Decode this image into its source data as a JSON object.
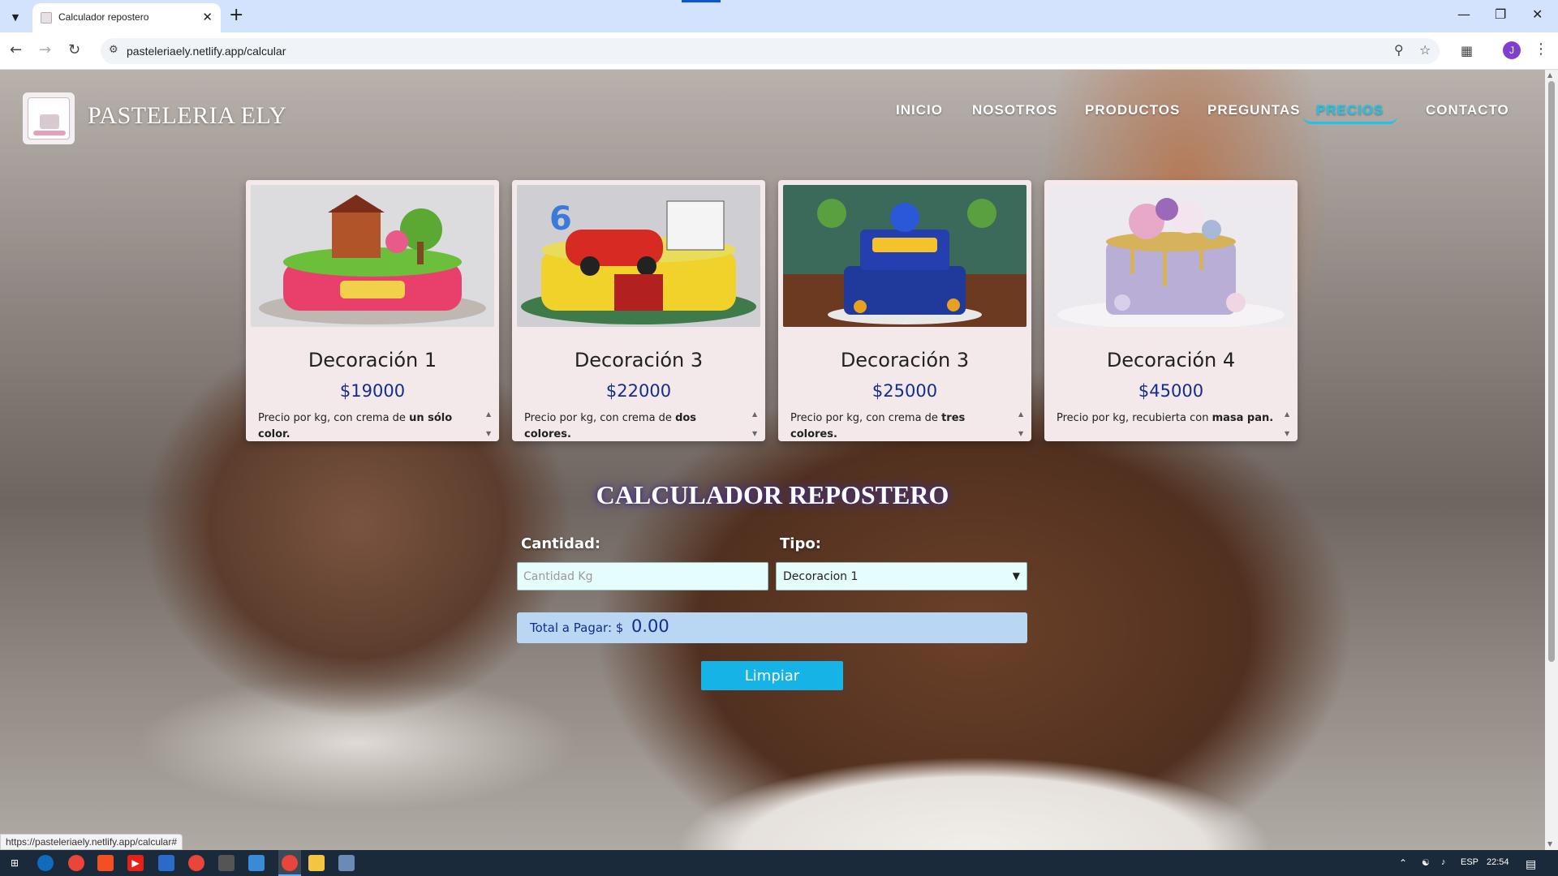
{
  "browser": {
    "tab_title": "Calculador repostero",
    "url": "pasteleriaely.netlify.app/calcular",
    "profile_initial": "J"
  },
  "site": {
    "brand": "PASTELERIA ELY",
    "nav": [
      {
        "label": "INICIO",
        "active": false
      },
      {
        "label": "NOSOTROS",
        "active": false
      },
      {
        "label": "PRODUCTOS",
        "active": false
      },
      {
        "label": "PREGUNTAS",
        "active": false
      },
      {
        "label": "PRECIOS",
        "active": true
      },
      {
        "label": "CONTACTO",
        "active": false
      }
    ]
  },
  "cards": [
    {
      "title": "Decoración 1",
      "price": "$19000",
      "desc_prefix": "Precio por kg, con crema de ",
      "desc_bold": "un sólo color.",
      "image": "cartoon-bear-cake"
    },
    {
      "title": "Decoración 3",
      "price": "$22000",
      "desc_prefix": "Precio por kg, con crema de ",
      "desc_bold": "dos colores.",
      "image": "race-car-cake"
    },
    {
      "title": "Decoración 3",
      "price": "$25000",
      "desc_prefix": "Precio por kg, con crema de ",
      "desc_bold": "tres colores.",
      "image": "hedgehog-cake"
    },
    {
      "title": "Decoración 4",
      "price": "$45000",
      "desc_prefix": "Precio por kg, recubierta con ",
      "desc_bold": "masa pan.",
      "image": "floral-drip-cake"
    }
  ],
  "calculator": {
    "title": "CALCULADOR REPOSTERO",
    "quantity_label": "Cantidad:",
    "quantity_placeholder": "Cantidad Kg",
    "type_label": "Tipo:",
    "type_selected": "Decoracion 1",
    "total_label": "Total a Pagar: $",
    "total_value": "0.00",
    "clear_label": "Limpiar"
  },
  "status_bar_url": "https://pasteleriaely.netlify.app/calcular#",
  "taskbar": {
    "language": "ESP",
    "time": "22:54"
  },
  "colors": {
    "accent": "#18c6ea",
    "price_blue": "#142c8c",
    "button": "#16b3e6"
  }
}
